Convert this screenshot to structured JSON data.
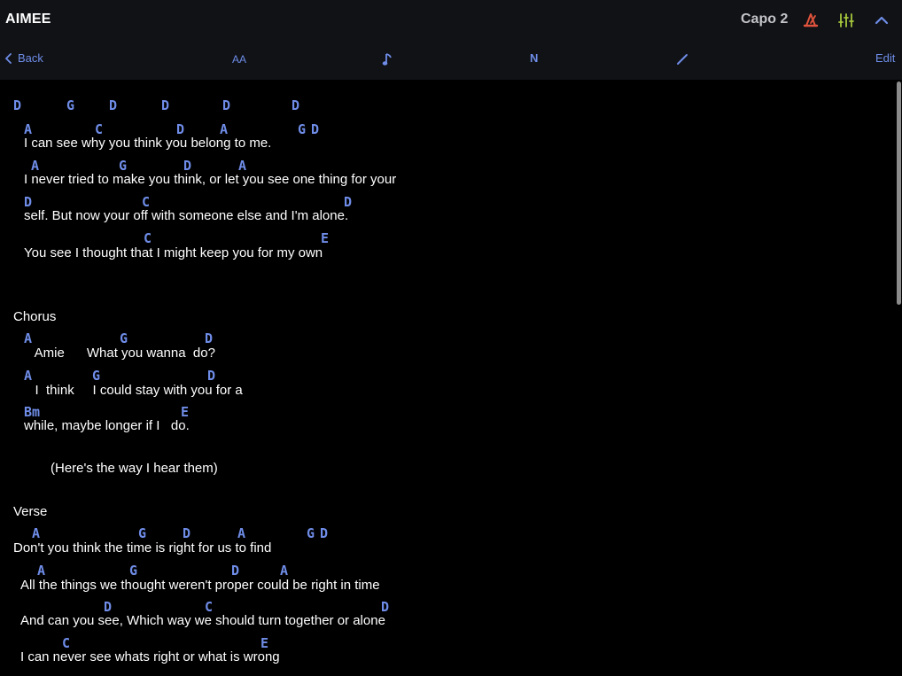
{
  "header": {
    "title": "AIMEE",
    "capo_label": "Capo 2"
  },
  "toolbar": {
    "back_label": "Back",
    "font_size_label": "AA",
    "notation_label": "N",
    "edit_label": "Edit"
  },
  "colors": {
    "chord": "#6f8de8",
    "metronome_icon": "#e0533c",
    "mixer_icon": "#a6c73c",
    "toolbar_accent": "#6f8de8"
  },
  "song": {
    "intro_chords": [
      "D",
      "G",
      "D",
      "D",
      "D",
      "D"
    ],
    "verse1": [
      {
        "chords": [
          "A",
          "C",
          "D",
          "A",
          "G",
          "D"
        ],
        "lyric": "I can see why you think you belong to me."
      },
      {
        "chords": [
          "A",
          "G",
          "D",
          "A"
        ],
        "lyric": "I never tried to make you think, or let you see one thing for your"
      },
      {
        "chords": [
          "D",
          "C",
          "D"
        ],
        "lyric": "self. But now your off with someone else and I'm alone."
      },
      {
        "chords": [
          "C",
          "E"
        ],
        "lyric": "You see I thought that I might keep you for my own"
      }
    ],
    "chorus_label": "Chorus",
    "chorus": [
      {
        "chords": [
          "A",
          "G",
          "D"
        ],
        "lyric": "   Amie      What you wanna  do?"
      },
      {
        "chords": [
          "A",
          "G",
          "D"
        ],
        "lyric": "   I  think     I could stay with you for a"
      },
      {
        "chords": [
          "Bm",
          "E"
        ],
        "lyric": "while, maybe longer if I   do."
      }
    ],
    "note": "(Here's the way I hear them)",
    "verse_label": "Verse",
    "verse2": [
      {
        "chords": [
          "A",
          "G",
          "D",
          "A",
          "G",
          "D"
        ],
        "lyric": "Don't you think the time is right for us to find"
      },
      {
        "chords": [
          "A",
          "G",
          "D",
          "A"
        ],
        "lyric": "All the things we thought weren't proper could be right in time"
      },
      {
        "chords": [
          "D",
          "C",
          "D"
        ],
        "lyric": "And can you see, Which way we should turn together or alone"
      },
      {
        "chords": [
          "C",
          "E"
        ],
        "lyric": "I can never see whats right or what is wrong"
      }
    ]
  }
}
